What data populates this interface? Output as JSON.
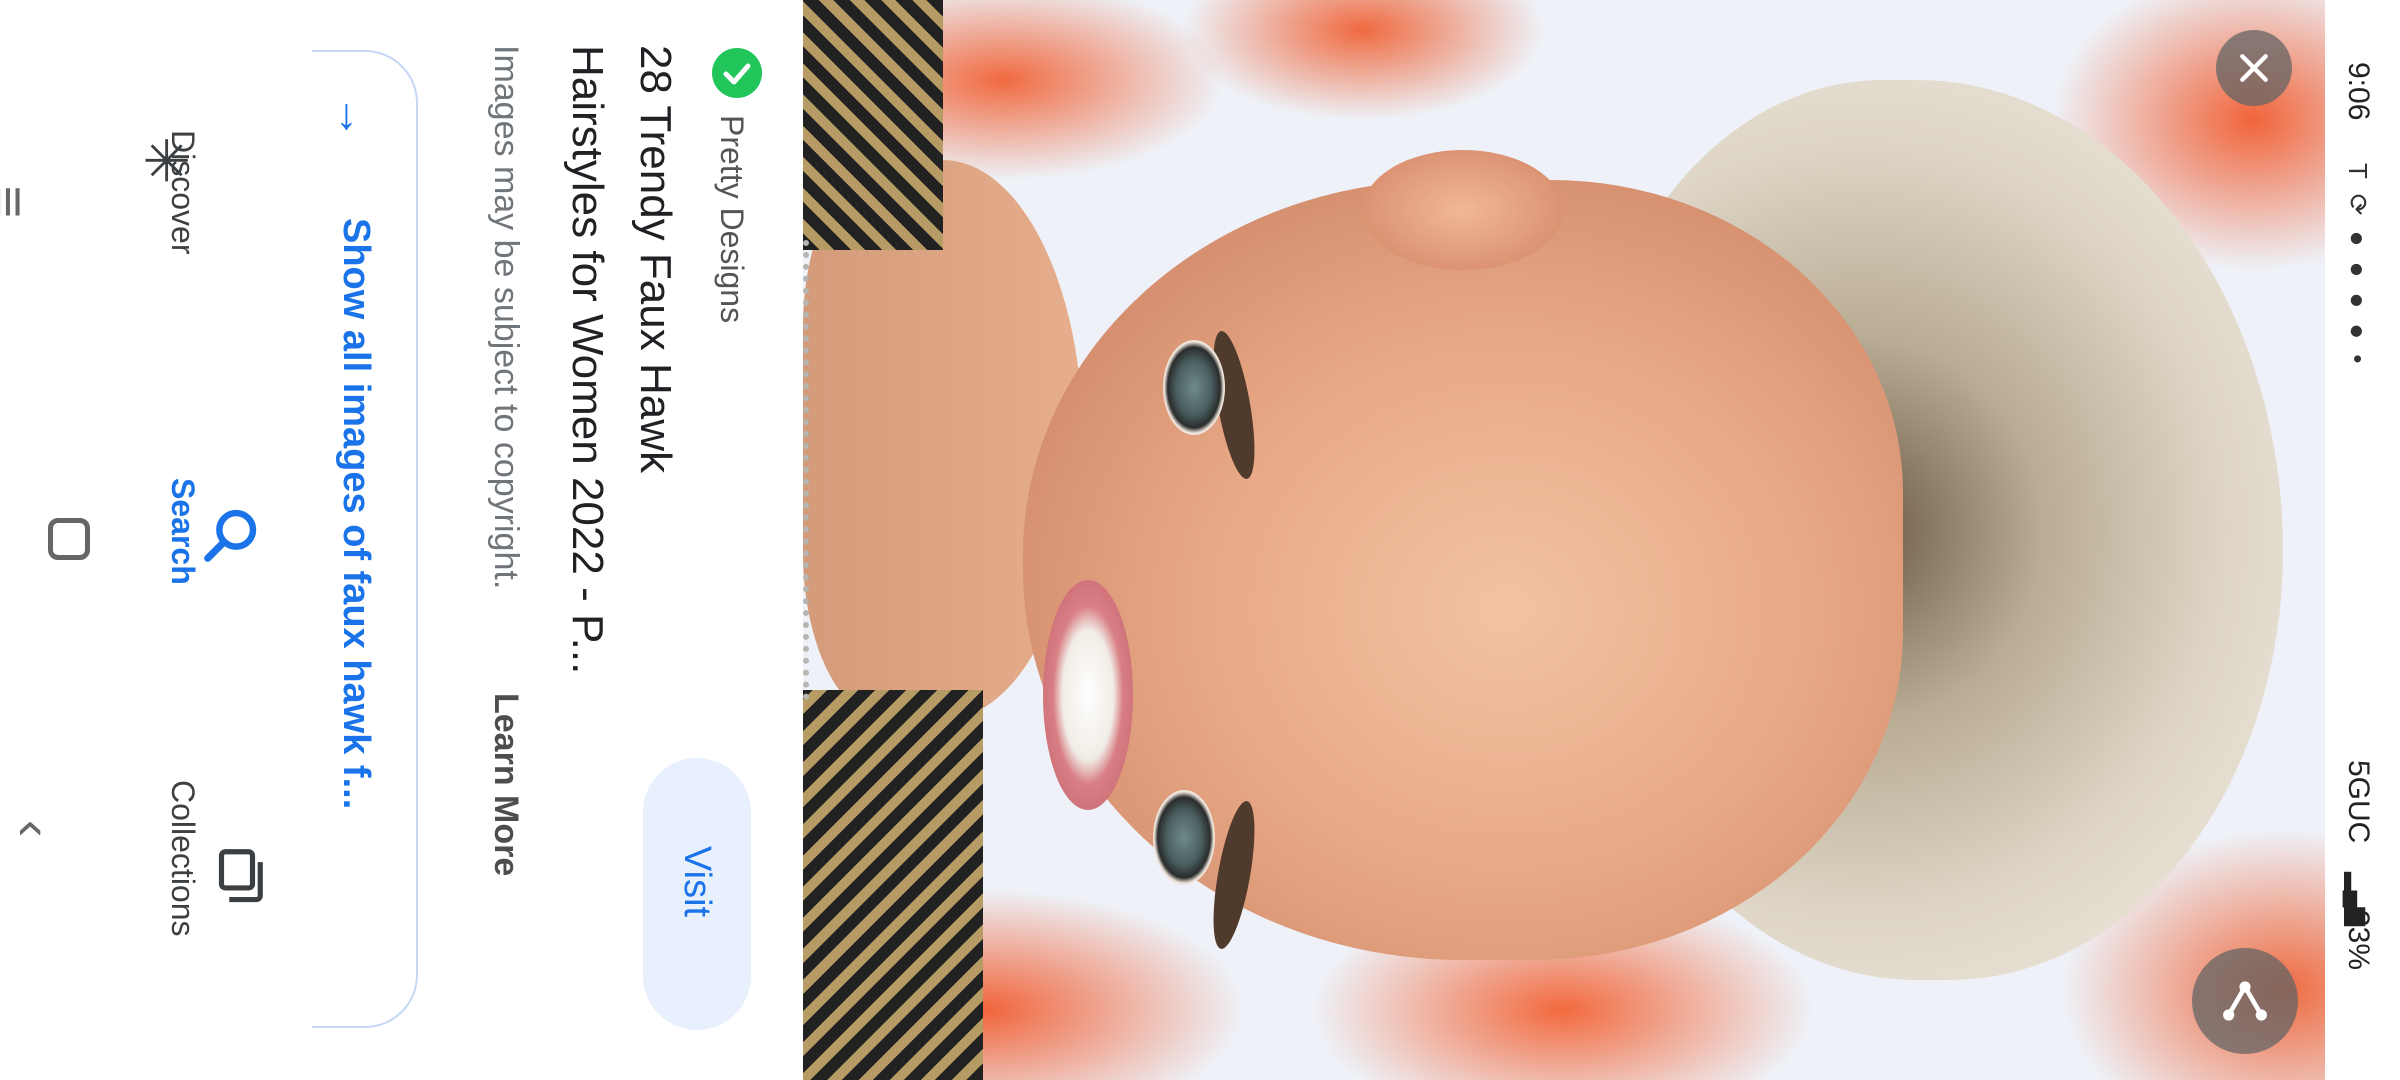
{
  "status_bar": {
    "time": "9:06",
    "icons": "T ⟳ ● ● ● ● •",
    "network": "5GUC",
    "signal": "▂▄▆",
    "battery": "33%"
  },
  "viewer": {
    "close_icon": "close-icon",
    "share_icon": "share-icon"
  },
  "info": {
    "source_name": "Pretty Designs",
    "title_line1": "28 Trendy Faux Hawk",
    "title_line2": "Hairstyles for Women 2022 - P...",
    "visit_label": "Visit",
    "copyright_text": "Images may be subject to copyright.",
    "learn_more_label": "Learn More",
    "show_all_label": "Show all images of faux hawk f..."
  },
  "bottom_nav": {
    "items": [
      {
        "label": "Discover",
        "icon": "asterisk-icon"
      },
      {
        "label": "Search",
        "icon": "search-icon",
        "active": true
      },
      {
        "label": "Collections",
        "icon": "collections-icon"
      }
    ]
  },
  "system_nav": {
    "recent": "≡",
    "back": "‹"
  },
  "colors": {
    "accent": "#1a73e8",
    "visit_bg": "#e8f0fe",
    "source_dot": "#21c55a"
  }
}
